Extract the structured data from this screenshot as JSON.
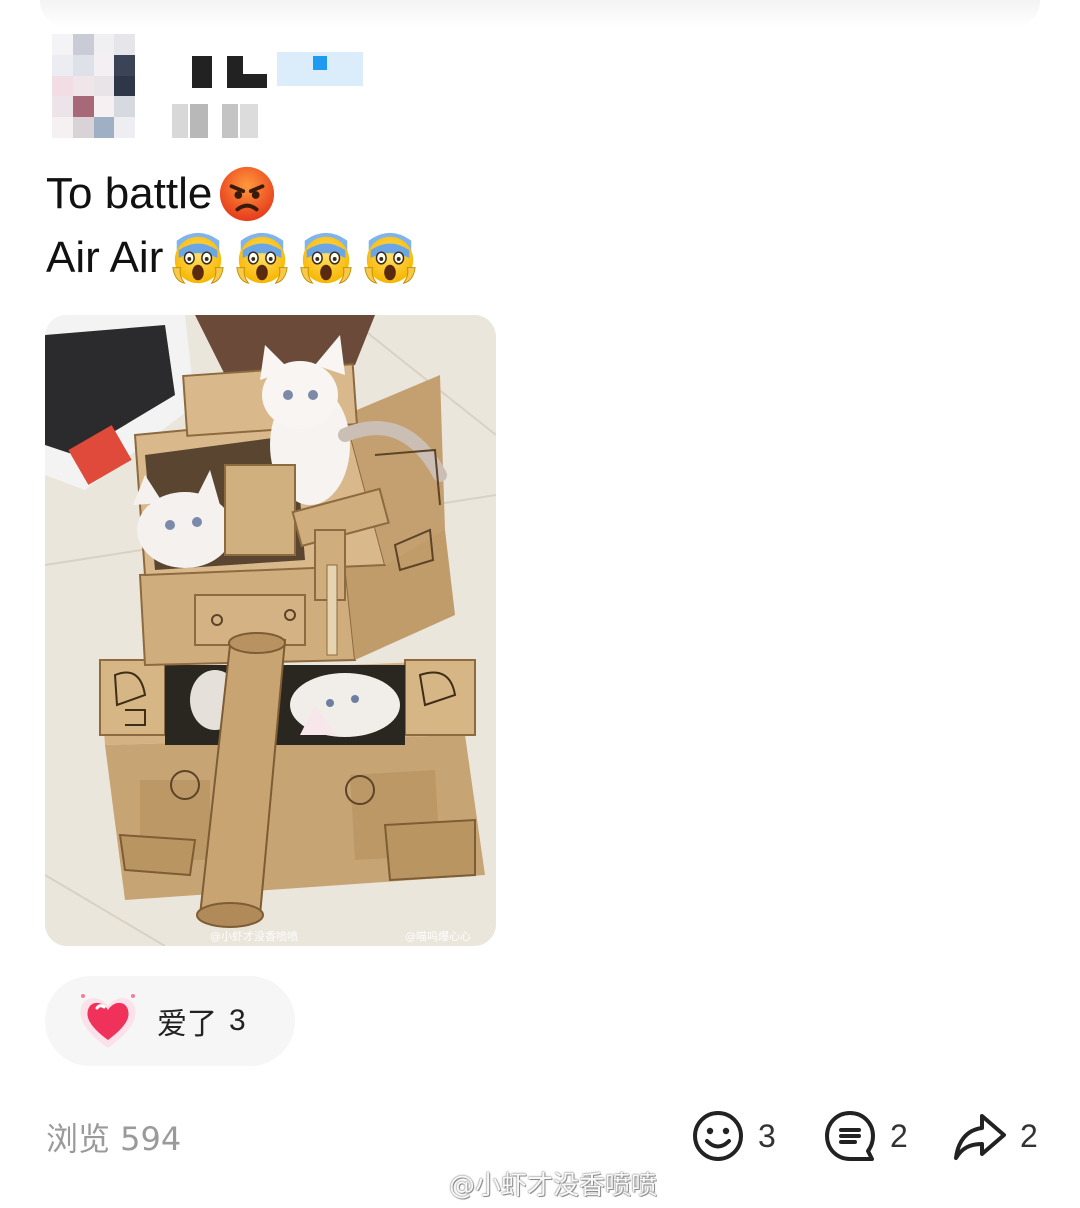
{
  "post": {
    "line1_text": "To battle",
    "line1_emoji": "angry-face-icon",
    "line2_text": "Air Air",
    "line2_emojis": [
      "face-screaming-in-fear-icon",
      "face-screaming-in-fear-icon",
      "face-screaming-in-fear-icon",
      "face-screaming-in-fear-icon"
    ],
    "photo_watermark_left": "@小虾才没香喷喷",
    "photo_watermark_right": "@喵呜爆心心"
  },
  "reaction": {
    "label": "爱了",
    "count": "3",
    "icon": "heart-icon"
  },
  "footer": {
    "views_label": "浏览 594",
    "like_count": "3",
    "comment_count": "2",
    "share_count": "2"
  },
  "watermark": {
    "text": "@小虾才没香喷喷"
  },
  "colors": {
    "text": "#111111",
    "muted": "#9a9a9a",
    "chip_bg": "#f6f6f6",
    "heart": "#f0325a"
  }
}
